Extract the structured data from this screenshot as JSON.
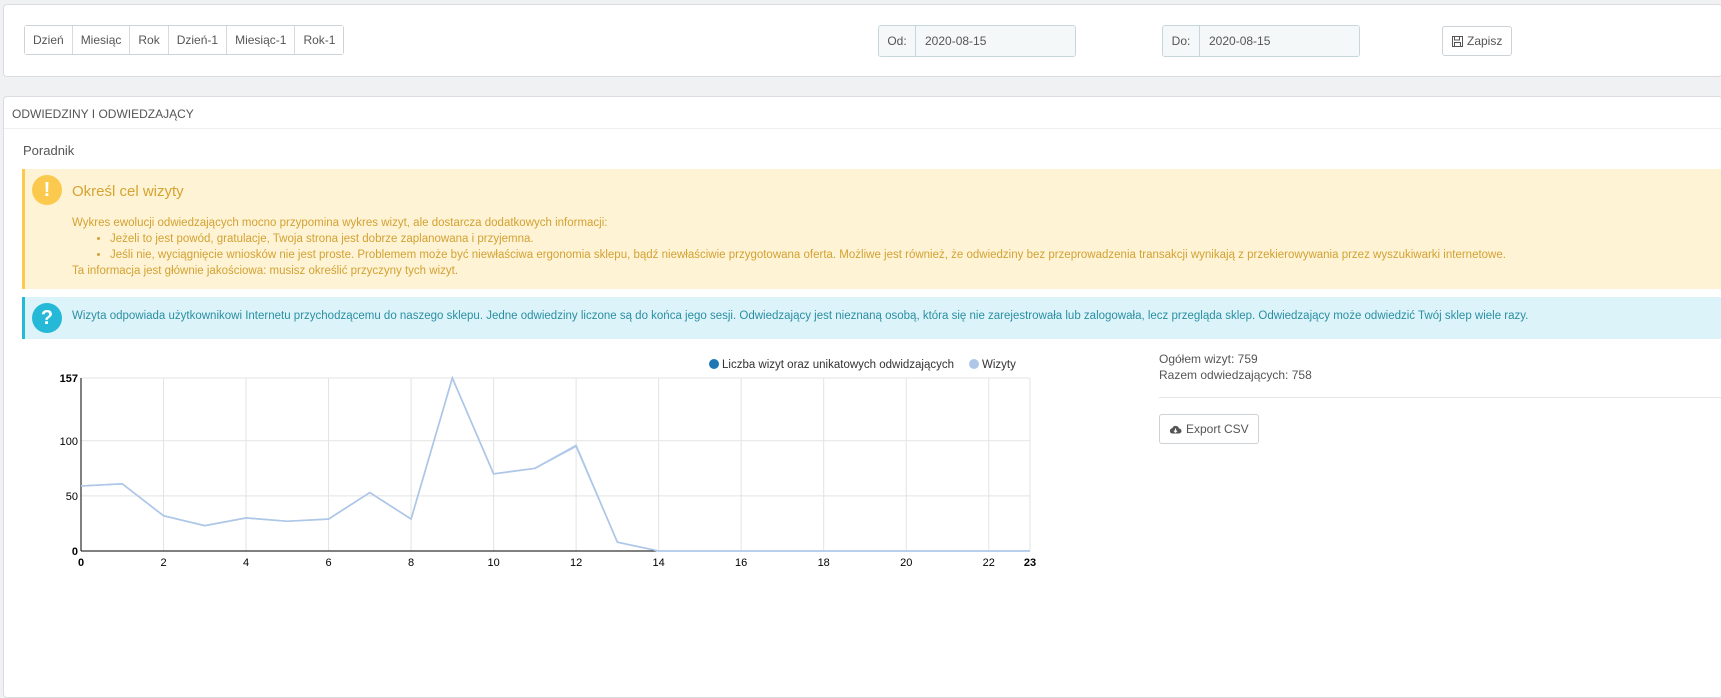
{
  "toolbar": {
    "period_buttons": [
      "Dzień",
      "Miesiąc",
      "Rok",
      "Dzień-1",
      "Miesiąc-1",
      "Rok-1"
    ],
    "from_label": "Od:",
    "from_value": "2020-08-15",
    "to_label": "Do:",
    "to_value": "2020-08-15",
    "save_label": "Zapisz"
  },
  "panel": {
    "heading": "ODWIEDZINY I ODWIEDZAJĄCY",
    "guide_title": "Poradnik"
  },
  "warning": {
    "title": "Określ cel wizyty",
    "intro": "Wykres ewolucji odwiedzających mocno przypomina wykres wizyt, ale dostarcza dodatkowych informacji:",
    "items": [
      "Jeżeli to jest powód, gratulacje, Twoja strona jest dobrze zaplanowana i przyjemna.",
      "Jeśli nie, wyciągnięcie wniosków nie jest proste. Problemem może być niewłaściwa ergonomia sklepu, bądź niewłaściwie przygotowana oferta. Możliwe jest również, że odwiedziny bez przeprowadzenia transakcji wynikają z przekierowywania przez wyszukiwarki internetowe."
    ],
    "outro": "Ta informacja jest głównie jakościowa: musisz określić przyczyny tych wizyt."
  },
  "info": {
    "text": "Wizyta odpowiada użytkownikowi Internetu przychodzącemu do naszego sklepu. Jedne odwiedziny liczone są do końca jego sesji. Odwiedzający jest nieznaną osobą, która się nie zarejestrowała lub zalogowała, lecz przegląda sklep. Odwiedzający może odwiedzić Twój sklep wiele razy."
  },
  "totals": {
    "visits": "Ogółem wizyt: 759",
    "visitors": "Razem odwiedzających: 758",
    "export_label": "Export CSV"
  },
  "colors": {
    "series_dark": "#1f77b4",
    "series_light": "#aec7e8",
    "warning_border": "#fcc94f",
    "info_border": "#25b9d7"
  },
  "chart_data": {
    "type": "line",
    "x": [
      0,
      1,
      2,
      3,
      4,
      5,
      6,
      7,
      8,
      9,
      10,
      11,
      12,
      13,
      14,
      15,
      16,
      17,
      18,
      19,
      20,
      21,
      22,
      23
    ],
    "series": [
      {
        "name": "Liczba wizyt oraz unikatowych odwidzających",
        "values": [
          59,
          61,
          32,
          23,
          30,
          27,
          29,
          53,
          29,
          157,
          70,
          75,
          96,
          8,
          0,
          0,
          0,
          0,
          0,
          0,
          0,
          0,
          0,
          0
        ]
      },
      {
        "name": "Wizyty",
        "values": [
          59,
          61,
          32,
          23,
          30,
          27,
          29,
          53,
          29,
          157,
          70,
          75,
          95,
          8,
          0,
          0,
          0,
          0,
          0,
          0,
          0,
          0,
          0,
          0
        ]
      }
    ],
    "xticks": [
      0,
      2,
      4,
      6,
      8,
      10,
      12,
      14,
      16,
      18,
      20,
      22,
      23
    ],
    "yticks": [
      0,
      50,
      100,
      157
    ],
    "xlim": [
      0,
      23
    ],
    "ylim": [
      0,
      157
    ],
    "grid": true,
    "legend": "top-right"
  }
}
